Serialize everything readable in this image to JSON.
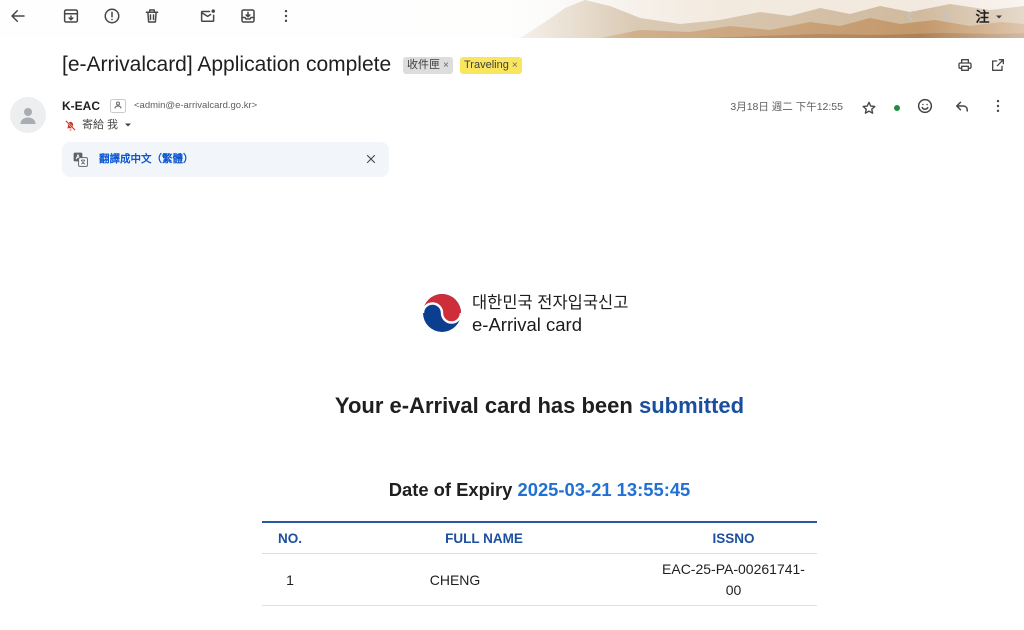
{
  "icons": {
    "toolbar_left": [
      "back-icon",
      "archive-icon",
      "report-spam-icon",
      "delete-icon",
      "mark-unread-icon",
      "move-to-icon",
      "more-vert-icon"
    ],
    "toolbar_right": [
      "chevron-left-icon",
      "chevron-right-icon",
      "chevron-down-icon"
    ],
    "subject_actions": [
      "print-icon",
      "open-in-new-icon"
    ],
    "message_actions": [
      "star-icon",
      "emoji-icon",
      "reply-icon",
      "more-vert-icon"
    ]
  },
  "toolbar": {
    "account_label": "注"
  },
  "subject": "[e-Arrivalcard] Application complete",
  "labels": [
    {
      "text": "收件匣",
      "remove": "×",
      "color": "#dddddd"
    },
    {
      "text": "Traveling",
      "remove": "×",
      "color": "#fae55f"
    }
  ],
  "sender": {
    "name": "K-EAC",
    "email": "<admin@e-arrivalcard.go.kr>",
    "recipient": "寄給 我",
    "date": "3月18日 週二 下午12:55"
  },
  "translate_bar": {
    "link": "翻譯成中文（繁體）"
  },
  "body": {
    "logo": {
      "korean": "대한민국 전자입국신고",
      "english": "e-Arrival card"
    },
    "heading": {
      "text": "Your e-Arrival card has been",
      "highlight": "submitted"
    },
    "expiry": {
      "label": "Date of Expiry",
      "value": "2025-03-21 13:55:45"
    },
    "table": {
      "headers": [
        "NO.",
        "FULL NAME",
        "ISSNO"
      ],
      "rows": [
        [
          "1",
          "CHENG",
          "EAC-25-PA-00261741-00"
        ]
      ]
    }
  },
  "colors": {
    "heading_highlight": "#1a4fa0",
    "expiry_value": "#2170d4",
    "table_accent": "#2857a4",
    "link_blue": "#0b57d0",
    "online_dot": "#1e8e3e"
  }
}
